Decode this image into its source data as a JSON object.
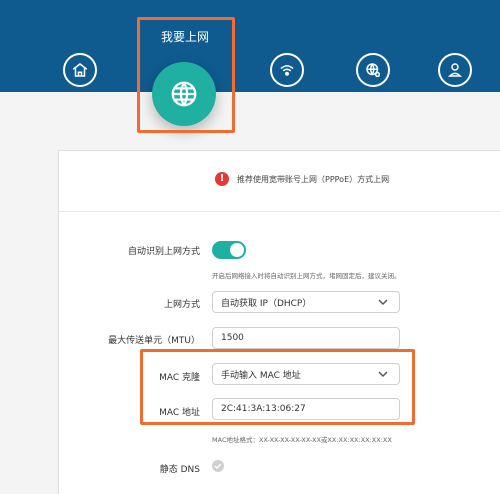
{
  "nav": {
    "active_label": "我要上网",
    "items": [
      {
        "icon": "home-icon"
      },
      {
        "icon": "globe-icon"
      },
      {
        "icon": "wifi-icon"
      },
      {
        "icon": "globe-settings-icon"
      },
      {
        "icon": "user-icon"
      }
    ]
  },
  "notice": {
    "text": "推荐使用宽带账号上网（PPPoE）方式上网"
  },
  "form": {
    "auto_detect": {
      "label": "自动识别上网方式",
      "enabled": true,
      "hint": "开启后网络接入时将自动识别上网方式，堵网固定后，建议关闭。"
    },
    "connection_type": {
      "label": "上网方式",
      "value": "自动获取 IP（DHCP）"
    },
    "mtu": {
      "label": "最大传送单元（MTU）",
      "value": "1500"
    },
    "mac_clone": {
      "label": "MAC 克隆",
      "value": "手动输入 MAC 地址"
    },
    "mac_address": {
      "label": "MAC 地址",
      "value": "2C:41:3A:13:06:27",
      "hint": "MAC地址格式：XX-XX-XX-XX-XX-XX或XX:XX:XX:XX:XX:XX"
    },
    "static_dns": {
      "label": "静态 DNS"
    }
  },
  "colors": {
    "header": "#0f5a8f",
    "accent": "#20b0a2",
    "highlight": "#f16c33",
    "warning": "#e53935"
  }
}
